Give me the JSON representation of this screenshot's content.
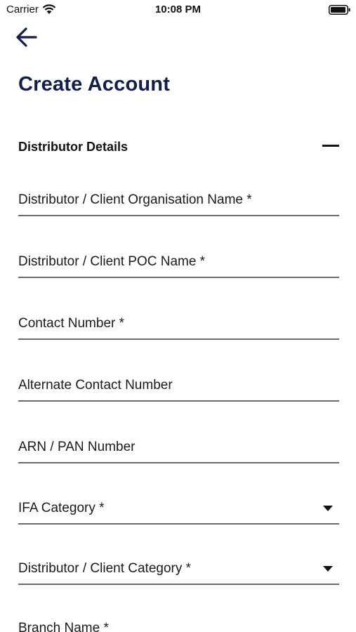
{
  "status_bar": {
    "carrier": "Carrier",
    "time": "10:08 PM",
    "wifi_icon": "wifi-icon",
    "battery_icon": "battery-icon"
  },
  "nav": {
    "back_icon": "arrow-left-icon"
  },
  "page": {
    "title": "Create Account"
  },
  "section": {
    "title": "Distributor Details",
    "toggle_icon": "minus-icon",
    "expanded": true
  },
  "fields": [
    {
      "label": "Distributor / Client Organisation Name *",
      "value": "",
      "type": "text"
    },
    {
      "label": "Distributor / Client POC Name *",
      "value": "",
      "type": "text"
    },
    {
      "label": "Contact Number *",
      "value": "",
      "type": "text"
    },
    {
      "label": "Alternate Contact Number",
      "value": "",
      "type": "text"
    },
    {
      "label": "ARN / PAN Number",
      "value": "",
      "type": "text"
    },
    {
      "label": "IFA Category *",
      "value": "",
      "type": "dropdown"
    },
    {
      "label": "Distributor / Client Category *",
      "value": "",
      "type": "dropdown"
    },
    {
      "label": "Branch Name *",
      "value": "",
      "type": "text"
    }
  ],
  "colors": {
    "title": "#0f1f4d",
    "back_arrow": "#0f1f4d",
    "underline": "#6b6b6b"
  }
}
